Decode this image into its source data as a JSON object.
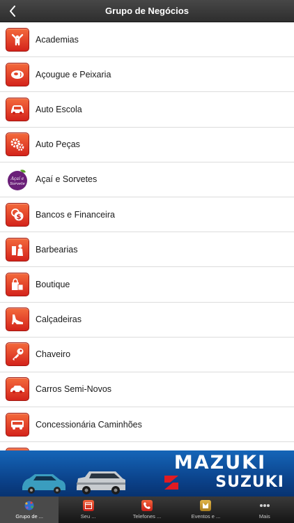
{
  "header": {
    "title": "Grupo de Negócios",
    "back_icon": "chevron-left-icon"
  },
  "categories": [
    {
      "label": "Academias",
      "icon": "fitness-icon"
    },
    {
      "label": "Açougue e Peixaria",
      "icon": "meat-icon"
    },
    {
      "label": "Auto Escola",
      "icon": "car-icon"
    },
    {
      "label": "Auto Peças",
      "icon": "gears-icon"
    },
    {
      "label": "Açaí e Sorvetes",
      "icon": "acai-logo-icon",
      "logo_text": "Açaí e Sorvete"
    },
    {
      "label": "Bancos e Financeira",
      "icon": "money-icon"
    },
    {
      "label": "Barbearias",
      "icon": "barber-icon"
    },
    {
      "label": "Boutique",
      "icon": "shopping-bag-icon"
    },
    {
      "label": "Calçadeiras",
      "icon": "shoe-icon"
    },
    {
      "label": "Chaveiro",
      "icon": "key-icon"
    },
    {
      "label": "Carros Semi-Novos",
      "icon": "car-icon"
    },
    {
      "label": "Concessionária Caminhões",
      "icon": "truck-icon"
    }
  ],
  "banner": {
    "brand": "MAZUKI",
    "sub_brand": "SUZUKI"
  },
  "tabs": [
    {
      "label": "Grupo de ...",
      "icon": "globe-icon",
      "active": true
    },
    {
      "label": "Seu ...",
      "icon": "calendar-icon",
      "active": false
    },
    {
      "label": "Telefones ...",
      "icon": "phone-icon",
      "active": false
    },
    {
      "label": "Eventos e ...",
      "icon": "events-icon",
      "active": false
    },
    {
      "label": "Mais",
      "icon": "more-dots-icon",
      "active": false
    }
  ],
  "colors": {
    "accent_red": "#d4231b",
    "navbar": "#2e2e2e",
    "banner_blue": "#0a3f86"
  }
}
